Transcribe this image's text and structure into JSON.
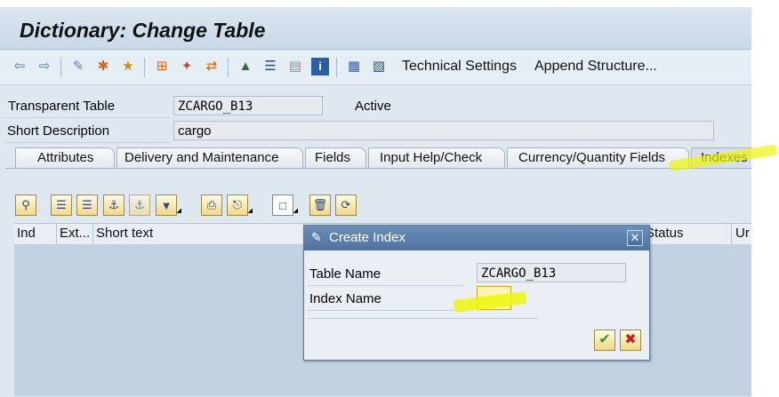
{
  "window": {
    "title": "Dictionary: Change Table"
  },
  "toolbar": {
    "icons": [
      "back-icon",
      "forward-icon",
      "display-change-icon",
      "check-icon",
      "activate-icon",
      "where-used-icon",
      "object-list-icon",
      "navigate-icon",
      "hierarchy-icon",
      "display-object-icon",
      "list-icon",
      "info-icon",
      "grid-icon",
      "table-icon"
    ],
    "technical_settings": "Technical Settings",
    "append_structure": "Append Structure..."
  },
  "header": {
    "table_type_label": "Transparent Table",
    "table_name": "ZCARGO_B13",
    "status": "Active",
    "short_description_label": "Short Description",
    "short_description": "cargo"
  },
  "tabs": [
    {
      "label": "Attributes"
    },
    {
      "label": "Delivery and Maintenance"
    },
    {
      "label": "Fields"
    },
    {
      "label": "Input Help/Check"
    },
    {
      "label": "Currency/Quantity Fields"
    },
    {
      "label": "Indexes"
    }
  ],
  "index_grid": {
    "columns": [
      "Ind",
      "Ext...",
      "Short text",
      "Status",
      "Ur"
    ]
  },
  "dialog": {
    "title": "Create Index",
    "table_name_label": "Table Name",
    "table_name_value": "ZCARGO_B13",
    "index_name_label": "Index Name",
    "index_name_value": "",
    "confirm_icon": "checkmark-icon",
    "cancel_icon": "cancel-icon"
  }
}
